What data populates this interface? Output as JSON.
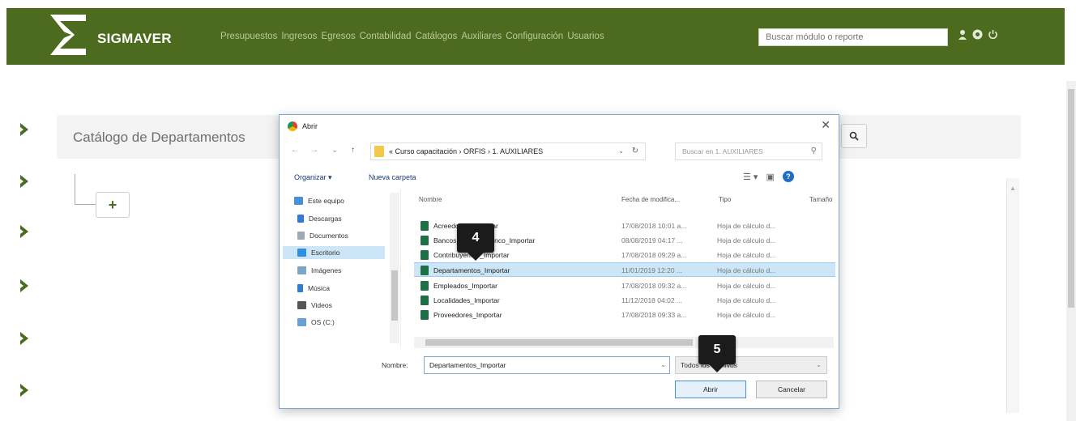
{
  "navbar": {
    "brand": "SIGMAVER",
    "menu": [
      "Presupuestos",
      "Ingresos",
      "Egresos",
      "Contabilidad",
      "Catálogos",
      "Auxiliares",
      "Configuración",
      "Usuarios"
    ],
    "search_placeholder": "Buscar módulo o reporte",
    "colors": {
      "navbar_bg": "#4d6b1f",
      "menu_text": "#b8c99b"
    }
  },
  "page": {
    "title": "Catálogo de Departamentos",
    "add_label": "+"
  },
  "dialog": {
    "title": "Abrir",
    "address_path": "« Curso capacitación › ORFIS › 1. AUXILIARES",
    "search_placeholder": "Buscar en 1. AUXILIARES",
    "toolbar": {
      "organize": "Organizar ▾",
      "new_folder": "Nueva carpeta"
    },
    "nav_items": [
      "Este equipo",
      "Descargas",
      "Documentos",
      "Escritorio",
      "Imágenes",
      "Música",
      "Videos",
      "OS (C:)"
    ],
    "selected_nav": "Escritorio",
    "columns": [
      "Nombre",
      "Fecha de modifica...",
      "Tipo",
      "Tamaño"
    ],
    "files": [
      {
        "name": "Acreedores_Importar",
        "date": "17/08/2018 10:01 a...",
        "type": "Hoja de cálculo d..."
      },
      {
        "name": "Bancos_CuentasBanco_Importar",
        "date": "08/08/2019 04:17 ...",
        "type": "Hoja de cálculo d..."
      },
      {
        "name": "Contribuyentes_Importar",
        "date": "17/08/2018 09:29 a...",
        "type": "Hoja de cálculo d..."
      },
      {
        "name": "Departamentos_Importar",
        "date": "11/01/2019 12:20 ...",
        "type": "Hoja de cálculo d..."
      },
      {
        "name": "Empleados_Importar",
        "date": "17/08/2018 09:32 a...",
        "type": "Hoja de cálculo d..."
      },
      {
        "name": "Localidades_Importar",
        "date": "11/12/2018 04:02 ...",
        "type": "Hoja de cálculo d..."
      },
      {
        "name": "Proveedores_Importar",
        "date": "17/08/2018 09:33 a...",
        "type": "Hoja de cálculo d..."
      }
    ],
    "selected_file": "Departamentos_Importar",
    "filename_label": "Nombre:",
    "filename_value": "Departamentos_Importar",
    "filetype_value": "Todos los archivos",
    "open_label": "Abrir",
    "cancel_label": "Cancelar"
  },
  "callouts": [
    "4",
    "5"
  ],
  "icons": [
    "sigmaver-logo-icon",
    "user-icon",
    "help-circle-icon",
    "logout-icon",
    "chevron-right-icon",
    "search-icon",
    "chrome-icon",
    "folder-icon",
    "excel-file-icon",
    "help-icon",
    "close-icon"
  ]
}
